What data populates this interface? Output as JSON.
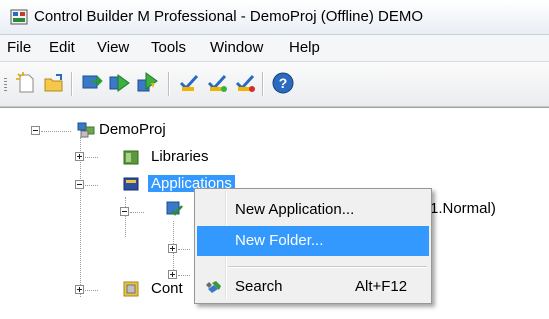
{
  "window": {
    "title": "Control Builder M Professional - DemoProj   (Offline) DEMO"
  },
  "menubar": {
    "items": [
      "File",
      "Edit",
      "View",
      "Tools",
      "Window",
      "Help"
    ]
  },
  "toolbar": {
    "buttons": [
      "new-project-icon",
      "open-project-icon",
      "download-icon",
      "go-online-icon",
      "download-go-online-icon",
      "check-icon",
      "check-all-icon",
      "check-errors-icon",
      "help-icon"
    ]
  },
  "tree": {
    "root": "DemoProj",
    "libraries": "Libraries",
    "applications": "Applications",
    "app_child_suffix": "1.Normal)",
    "controllers_partial": "Cont"
  },
  "context_menu": {
    "new_application": "New Application...",
    "new_folder": "New Folder...",
    "search": "Search",
    "search_shortcut": "Alt+F12"
  },
  "colors": {
    "selection": "#3399ff"
  }
}
